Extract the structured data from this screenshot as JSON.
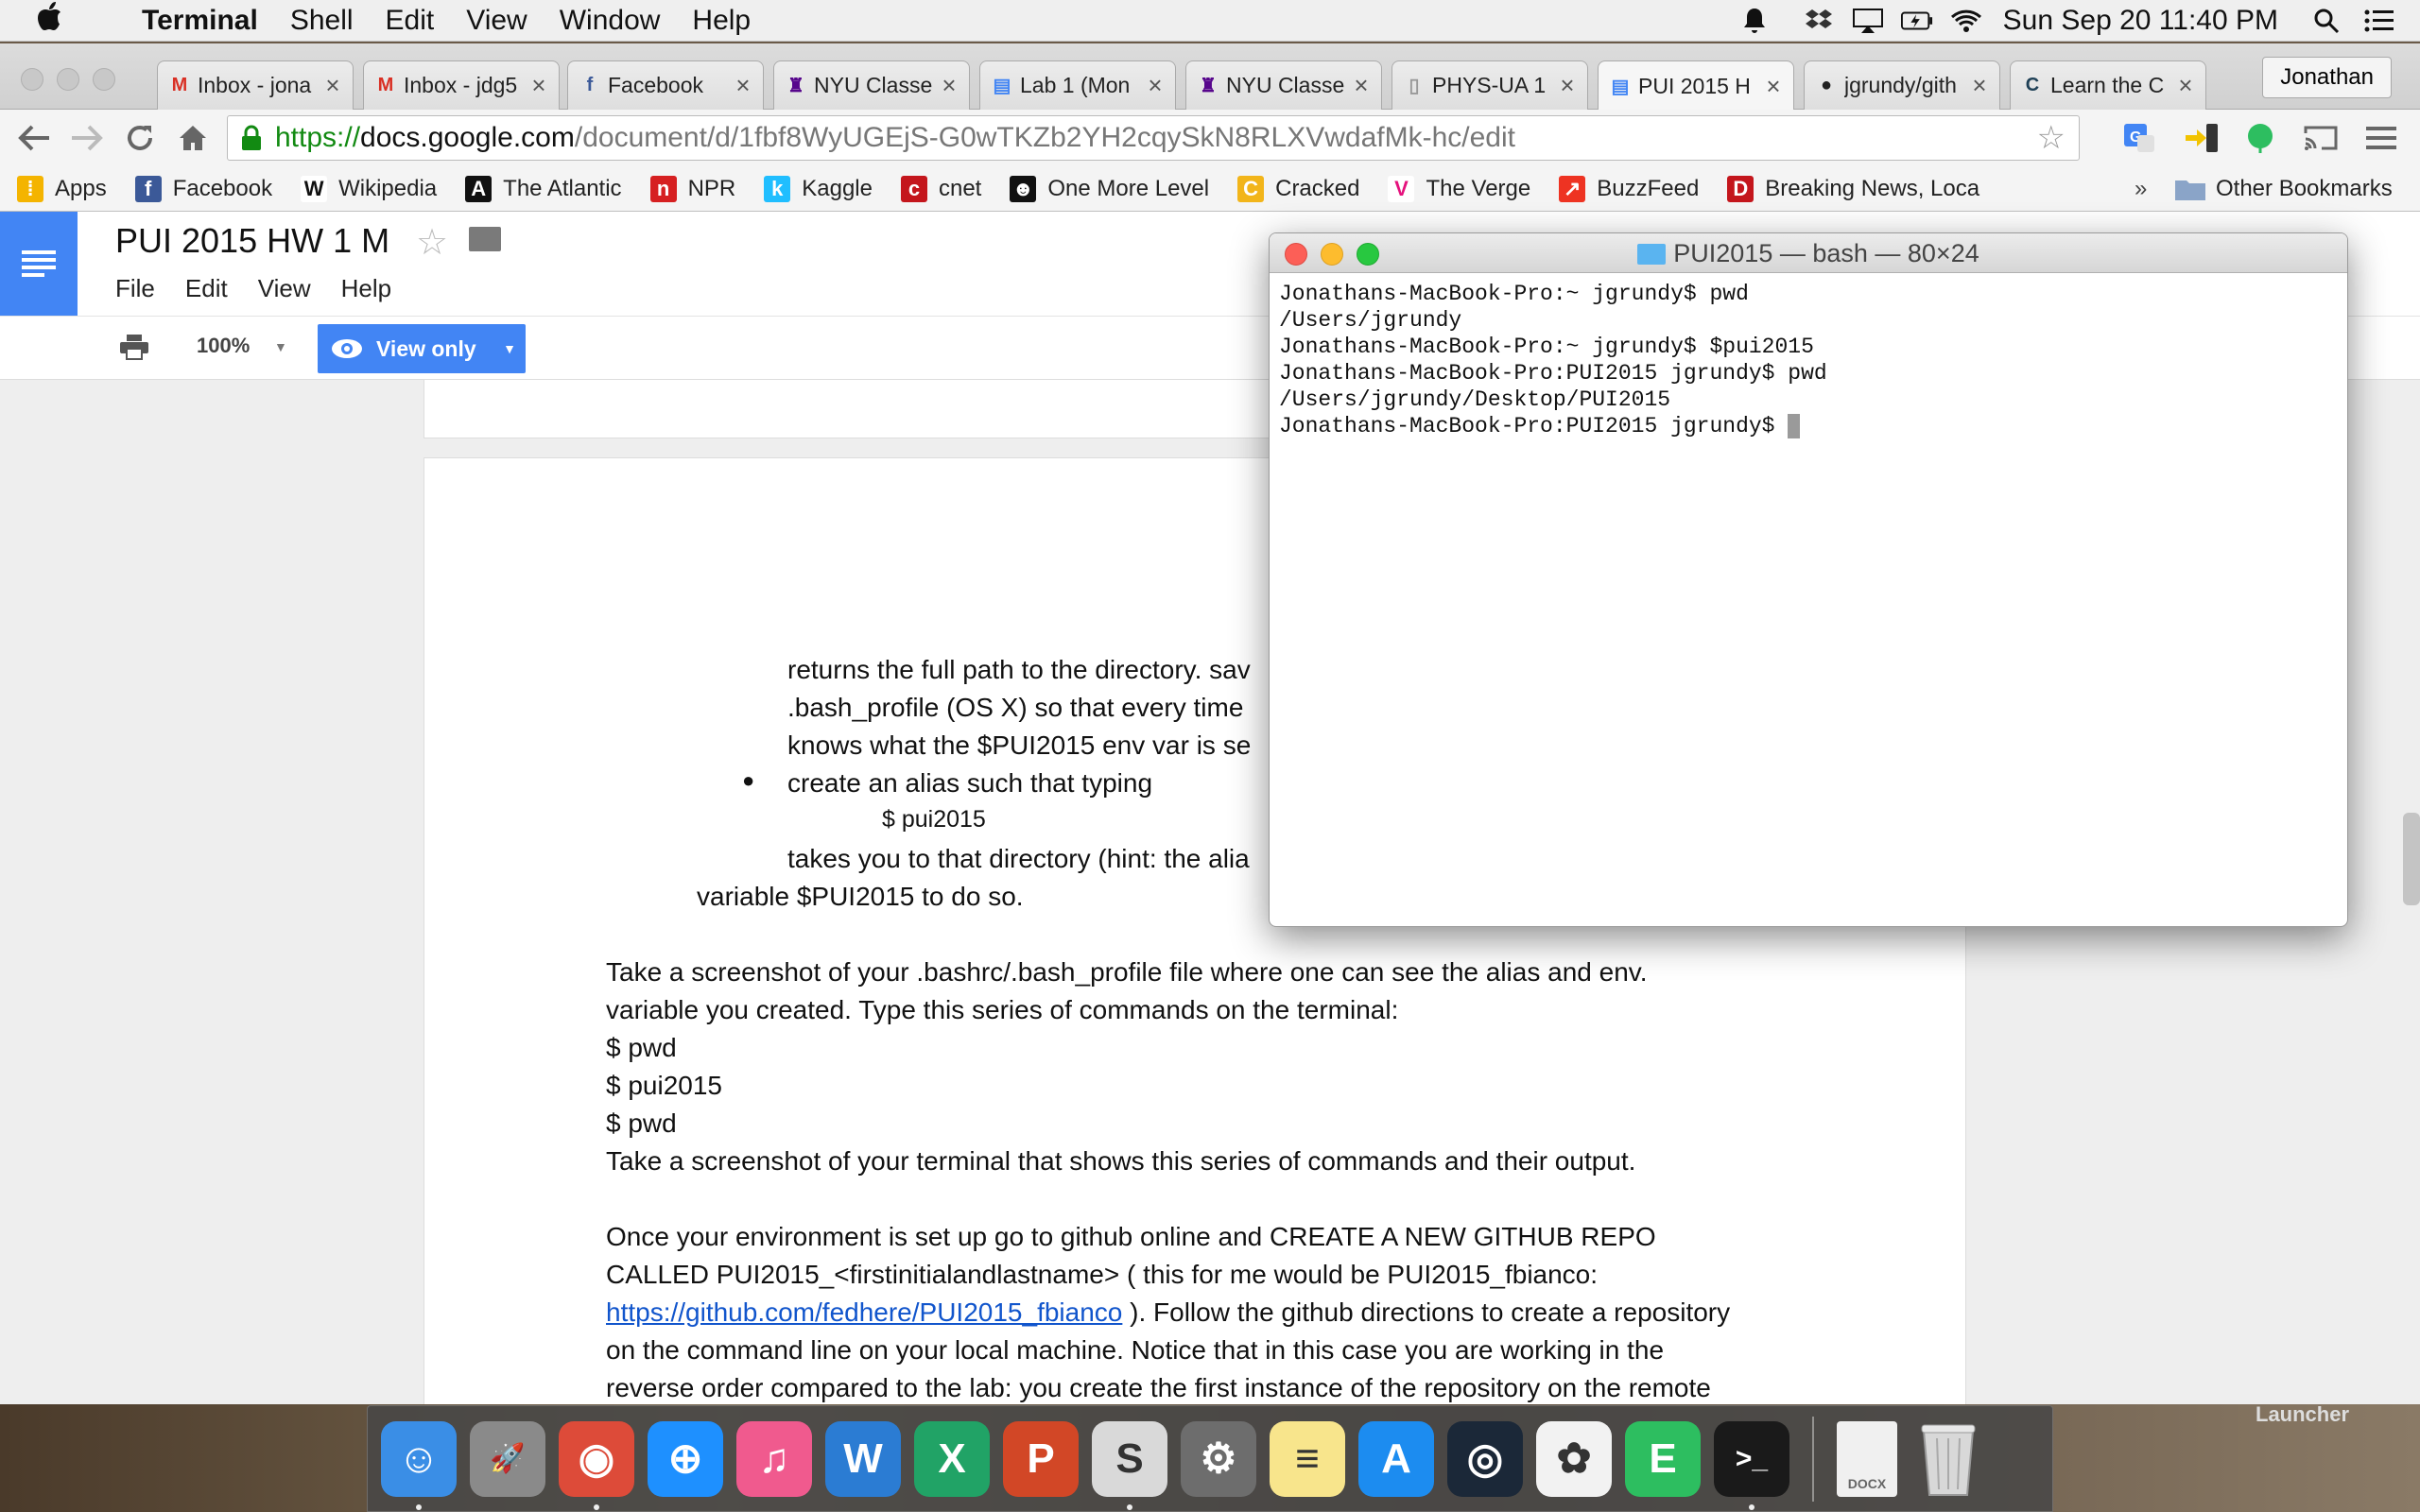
{
  "menubar": {
    "app_name": "Terminal",
    "menus": [
      "Shell",
      "Edit",
      "View",
      "Window",
      "Help"
    ],
    "clock": "Sun Sep 20  11:40 PM"
  },
  "chrome": {
    "tabs": [
      {
        "label": "Inbox - jona",
        "favicon": "gmail-icon",
        "color": "#d93025"
      },
      {
        "label": "Inbox - jdg5",
        "favicon": "gmail-icon",
        "color": "#d93025"
      },
      {
        "label": "Facebook",
        "favicon": "facebook-icon",
        "color": "#3b5998"
      },
      {
        "label": "NYU Classe",
        "favicon": "nyu-icon",
        "color": "#57068c"
      },
      {
        "label": "Lab 1 (Mon",
        "favicon": "docs-icon",
        "color": "#4285f4"
      },
      {
        "label": "NYU Classe",
        "favicon": "nyu-icon",
        "color": "#57068c"
      },
      {
        "label": "PHYS-UA 1",
        "favicon": "page-icon",
        "color": "#999999"
      },
      {
        "label": "PUI 2015 H",
        "favicon": "docs-icon",
        "color": "#4285f4"
      },
      {
        "label": "jgrundy/gith",
        "favicon": "github-icon",
        "color": "#222222"
      },
      {
        "label": "Learn the C",
        "favicon": "codecademy-icon",
        "color": "#1f4056"
      }
    ],
    "profile": "Jonathan",
    "url": {
      "proto": "https://",
      "host": "docs.google.com",
      "path": "/document/d/1fbf8WyUGEjS-G0wTKZb2YH2cqySkN8RLXVwdafMk-hc/edit"
    },
    "bookmarks": [
      {
        "label": "Apps",
        "icon": "apps-icon"
      },
      {
        "label": "Facebook",
        "icon": "facebook-icon"
      },
      {
        "label": "Wikipedia",
        "icon": "wikipedia-icon"
      },
      {
        "label": "The Atlantic",
        "icon": "atlantic-icon"
      },
      {
        "label": "NPR",
        "icon": "npr-icon"
      },
      {
        "label": "Kaggle",
        "icon": "kaggle-icon"
      },
      {
        "label": "cnet",
        "icon": "cnet-icon"
      },
      {
        "label": "One More Level",
        "icon": "omlevel-icon"
      },
      {
        "label": "Cracked",
        "icon": "cracked-icon"
      },
      {
        "label": "The Verge",
        "icon": "verge-icon"
      },
      {
        "label": "BuzzFeed",
        "icon": "buzzfeed-icon"
      },
      {
        "label": "Breaking News, Loca",
        "icon": "dnews-icon"
      }
    ],
    "other_bookmarks": "Other Bookmarks",
    "overflow": "»"
  },
  "docs": {
    "title": "PUI 2015 HW 1 M",
    "menus": [
      "File",
      "Edit",
      "View",
      "Help"
    ],
    "zoom": "100%",
    "mode_button": "View only",
    "lines": [
      "returns the full path to the directory. sav",
      ".bash_profile (OS X) so that every time",
      "knows what the $PUI2015 env var is se",
      "create an alias such that typing",
      "$ pui2015",
      "takes you to that directory (hint: the alia",
      "variable $PUI2015 to do so.",
      "Take a screenshot of your .bashrc/.bash_profile file where one can see the alias and env.",
      "variable you created. Type this series of commands on the terminal:",
      "$ pwd",
      "$ pui2015",
      "$ pwd",
      "Take a screenshot of your terminal that shows this series of commands and their output.",
      "Once your environment is set up go to github online and CREATE A NEW GITHUB REPO",
      "CALLED PUI2015_<firstinitialandlastname> ( this for me would be PUI2015_fbianco:",
      "https://github.com/fedhere/PUI2015_fbianco",
      " ). Follow the github directions to create a repository",
      "on the command line on your local machine.  Notice that in this case you are working in the",
      "reverse order compared to the lab: you create the first instance of the repository on the remote"
    ],
    "bullet": "●"
  },
  "terminal": {
    "title": "PUI2015 — bash — 80×24",
    "lines": [
      "Jonathans-MacBook-Pro:~ jgrundy$ pwd",
      "/Users/jgrundy",
      "Jonathans-MacBook-Pro:~ jgrundy$ $pui2015",
      "Jonathans-MacBook-Pro:PUI2015 jgrundy$ pwd",
      "/Users/jgrundy/Desktop/PUI2015",
      "Jonathans-MacBook-Pro:PUI2015 jgrundy$ "
    ]
  },
  "dock": {
    "apps": [
      {
        "name": "finder-icon",
        "glyph": "☺",
        "bg": "#3a8ee6",
        "running": true
      },
      {
        "name": "launchpad-icon",
        "glyph": "🚀",
        "bg": "#8a8a8a",
        "running": false
      },
      {
        "name": "chrome-icon",
        "glyph": "◉",
        "bg": "#dd4b39",
        "running": true
      },
      {
        "name": "safari-icon",
        "glyph": "⊕",
        "bg": "#1e90ff",
        "running": false
      },
      {
        "name": "itunes-icon",
        "glyph": "♫",
        "bg": "#f05a8e",
        "running": false
      },
      {
        "name": "word-icon",
        "glyph": "W",
        "bg": "#2b7cd3",
        "running": false
      },
      {
        "name": "excel-icon",
        "glyph": "X",
        "bg": "#21a366",
        "running": false
      },
      {
        "name": "powerpoint-icon",
        "glyph": "P",
        "bg": "#d24726",
        "running": false
      },
      {
        "name": "slack-icon",
        "glyph": "S",
        "bg": "#d9d9d9",
        "running": true
      },
      {
        "name": "system-preferences-icon",
        "glyph": "⚙",
        "bg": "#6d6d6d",
        "running": false
      },
      {
        "name": "notes-icon",
        "glyph": "≡",
        "bg": "#f8e58c",
        "running": false
      },
      {
        "name": "app-store-icon",
        "glyph": "A",
        "bg": "#1c8cf0",
        "running": false
      },
      {
        "name": "steam-icon",
        "glyph": "◎",
        "bg": "#1b2838",
        "running": false
      },
      {
        "name": "photos-icon",
        "glyph": "✿",
        "bg": "#f2f2f2",
        "running": false
      },
      {
        "name": "evernote-icon",
        "glyph": "E",
        "bg": "#2dbe60",
        "running": false
      },
      {
        "name": "terminal-icon",
        "glyph": ">_",
        "bg": "#1a1a1a",
        "running": true
      }
    ],
    "docx_label": "DOCX",
    "launcher_label": "Launcher"
  }
}
